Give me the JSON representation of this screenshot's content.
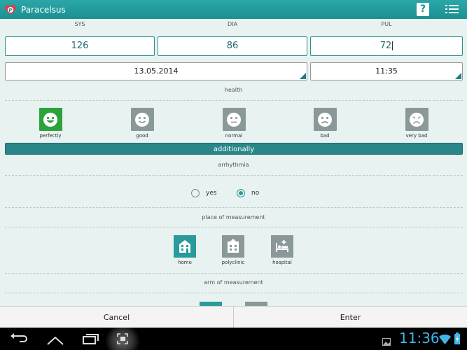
{
  "app": {
    "title": "Paracelsus",
    "help_label": "?"
  },
  "labels": {
    "sys": "SYS",
    "dia": "DIA",
    "pul": "PUL"
  },
  "values": {
    "sys": "126",
    "dia": "86",
    "pul": "72",
    "date": "13.05.2014",
    "time": "11:35"
  },
  "health": {
    "title": "health",
    "items": [
      {
        "label": "perfectly",
        "icon": "very-happy-face-icon",
        "selected": true
      },
      {
        "label": "good",
        "icon": "happy-face-icon",
        "selected": false
      },
      {
        "label": "normal",
        "icon": "neutral-face-icon",
        "selected": false
      },
      {
        "label": "bad",
        "icon": "sad-face-icon",
        "selected": false
      },
      {
        "label": "very bad",
        "icon": "very-sad-face-icon",
        "selected": false
      }
    ]
  },
  "additionally": "additionally",
  "arrhythmia": {
    "title": "arrhythmia",
    "yes": "yes",
    "no": "no",
    "selected": "no"
  },
  "place": {
    "title": "place of measurement",
    "items": [
      {
        "label": "home",
        "icon": "building-icon",
        "selected": true
      },
      {
        "label": "polyclinic",
        "icon": "polyclinic-icon",
        "selected": false
      },
      {
        "label": "hospital",
        "icon": "hospital-bed-icon",
        "selected": false
      }
    ]
  },
  "arm": {
    "title": "arm of measurement"
  },
  "buttons": {
    "cancel": "Cancel",
    "enter": "Enter"
  },
  "system": {
    "clock": "11:36"
  },
  "colors": {
    "accent": "#1b8f92",
    "selected_green": "#2aa33a",
    "clock_blue": "#40b6e8"
  }
}
